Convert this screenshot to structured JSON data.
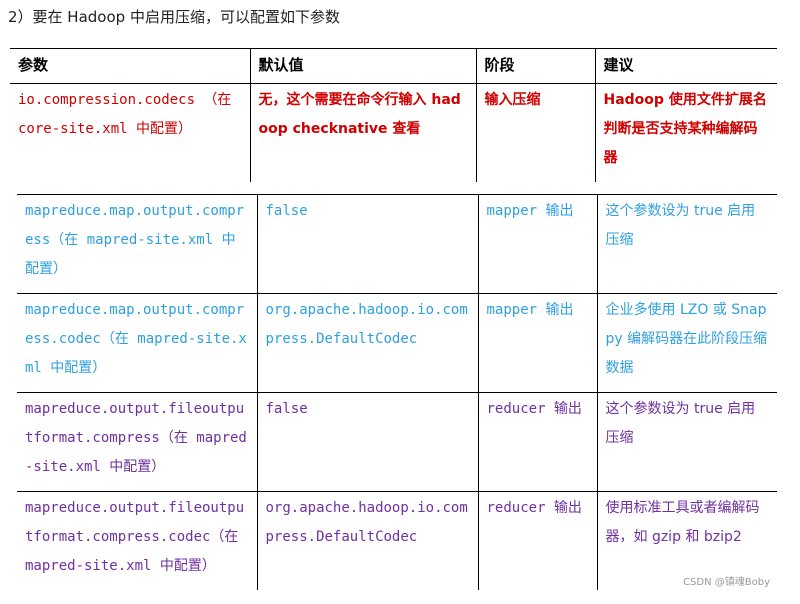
{
  "heading": "2）要在 Hadoop 中启用压缩，可以配置如下参数",
  "top_table": {
    "headers": [
      "参数",
      "默认值",
      "阶段",
      "建议"
    ],
    "row": [
      "io.compression.codecs （在 core-site.xml 中配置）",
      "无，这个需要在命令行输入 hadoop checknative 查看",
      "输入压缩",
      "Hadoop 使用文件扩展名判断是否支持某种编解码器"
    ]
  },
  "bottom_table": {
    "rows": [
      [
        "mapreduce.map.output.compress（在 mapred-site.xml 中配置）",
        "false",
        "mapper 输出",
        "这个参数设为 true 启用压缩"
      ],
      [
        "mapreduce.map.output.compress.codec（在 mapred-site.xml 中配置）",
        "org.apache.hadoop.io.compress.DefaultCodec",
        "mapper 输出",
        "企业多使用 LZO 或 Snappy 编解码器在此阶段压缩数据"
      ],
      [
        "mapreduce.output.fileoutputformat.compress（在 mapred-site.xml 中配置）",
        "false",
        "reducer 输出",
        "这个参数设为 true 启用压缩"
      ],
      [
        "mapreduce.output.fileoutputformat.compress.codec（在 mapred-site.xml 中配置）",
        "org.apache.hadoop.io.compress.DefaultCodec",
        "reducer 输出",
        "使用标准工具或者编解码器，如 gzip 和 bzip2"
      ]
    ]
  },
  "watermark": "CSDN @镇魂Boby",
  "colors": {
    "red": "#d00000",
    "blue": "#2ea0e0",
    "purple": "#7030a0"
  }
}
